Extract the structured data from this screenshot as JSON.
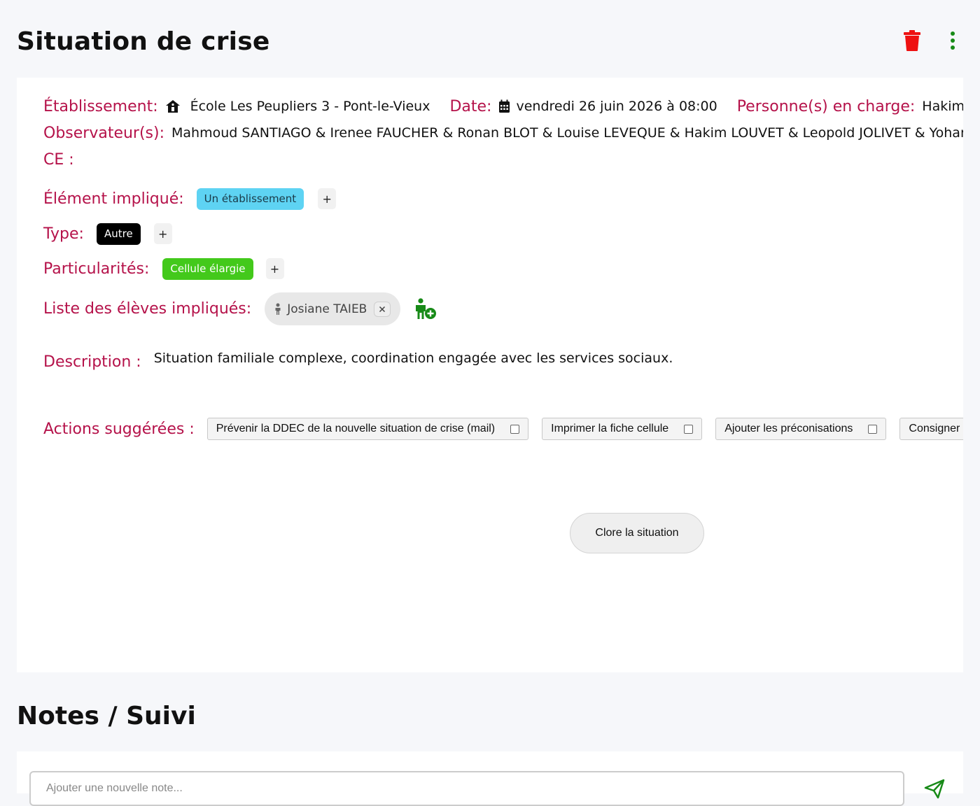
{
  "header": {
    "title": "Situation de crise"
  },
  "details": {
    "etablissement_label": "Établissement:",
    "etablissement_value": "École Les Peupliers 3 - Pont-le-Vieux",
    "date_label": "Date:",
    "date_value": "vendredi 26 juin 2026 à 08:00",
    "personnes_label": "Personne(s) en charge:",
    "personnes_value": "Hakim LOUVET",
    "observateurs_label": "Observateur(s):",
    "observateurs_value": "Mahmoud SANTIAGO & Irenee FAUCHER & Ronan BLOT & Louise LEVEQUE & Hakim LOUVET & Leopold JOLIVET & Yohann CHAUVET",
    "ce_label": "CE :"
  },
  "element": {
    "label": "Élément impliqué:",
    "tag": "Un établissement",
    "tag_color": "#5ed3f3"
  },
  "type": {
    "label": "Type:",
    "tag": "Autre",
    "tag_color": "#000000"
  },
  "particularites": {
    "label": "Particularités:",
    "tag": "Cellule élargie",
    "tag_color": "#43c91b"
  },
  "plus_symbol": "+",
  "eleves": {
    "label": "Liste des élèves impliqués:",
    "students": [
      "Josiane TAIEB"
    ]
  },
  "description": {
    "label": "Description :",
    "text": "Situation familiale complexe, coordination engagée avec les services sociaux."
  },
  "actions": {
    "label": "Actions suggérées :",
    "items": [
      "Prévenir la DDEC de la nouvelle situation de crise (mail)",
      "Imprimer la fiche cellule",
      "Ajouter les préconisations",
      "Consigner les motifs"
    ]
  },
  "close_button": "Clore la situation",
  "notes": {
    "title": "Notes / Suivi",
    "placeholder": "Ajouter une nouvelle note..."
  },
  "colors": {
    "label": "#b5124a",
    "delete": "#ee1111",
    "accent_green": "#178a17"
  },
  "icons": [
    "trash-icon",
    "kebab-menu-icon",
    "school-icon",
    "calendar-icon",
    "person-icon",
    "close-icon",
    "add-student-icon",
    "send-icon"
  ]
}
